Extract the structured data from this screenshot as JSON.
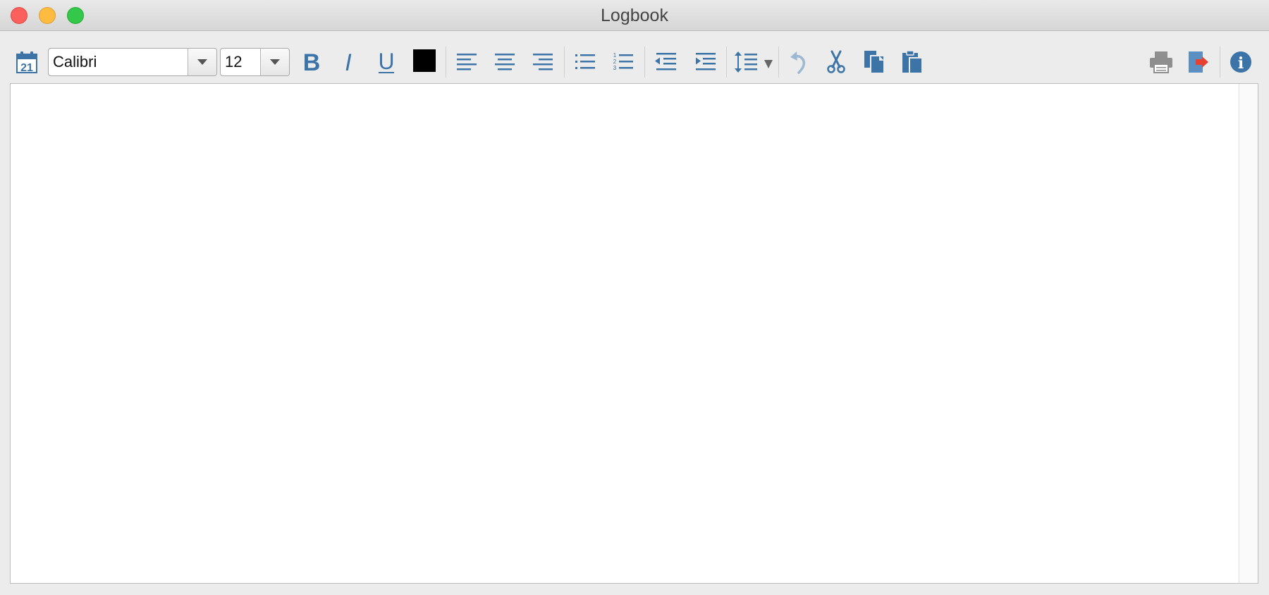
{
  "window": {
    "title": "Logbook"
  },
  "toolbar": {
    "date": {
      "day": "21",
      "icon": "calendar-icon"
    },
    "font_family": {
      "value": "Calibri"
    },
    "font_size": {
      "value": "12"
    },
    "text_color": "#000000",
    "accent_color": "#3d74a8",
    "icons": [
      "bold-icon",
      "italic-icon",
      "underline-icon",
      "text-color-swatch",
      "align-left-icon",
      "align-center-icon",
      "align-right-icon",
      "bullet-list-icon",
      "numbered-list-icon",
      "outdent-icon",
      "indent-icon",
      "line-spacing-icon",
      "undo-icon",
      "cut-icon",
      "copy-icon",
      "paste-icon",
      "print-icon",
      "export-icon",
      "info-icon"
    ],
    "numbered_list_digits": [
      "1",
      "2",
      "3"
    ],
    "bold_glyph": "B",
    "italic_glyph": "I",
    "underline_glyph": "U",
    "info_glyph": "i"
  },
  "editor": {
    "content": ""
  }
}
